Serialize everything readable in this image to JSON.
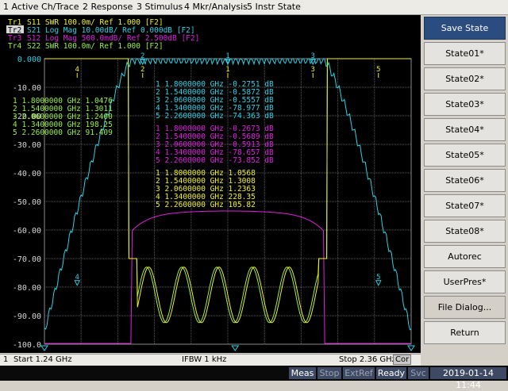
{
  "menu": [
    "1 Active Ch/Trace",
    "2 Response",
    "3 Stimulus",
    "4 Mkr/Analysis",
    "5 Instr State"
  ],
  "traces": [
    {
      "id": "Tr1",
      "param": "S11",
      "format": "SWR",
      "scale": "100.0m/",
      "ref": "Ref 1.000",
      "tag": "[F2]",
      "color": "#f2f21a",
      "active": false
    },
    {
      "id": "Tr2",
      "param": "S21",
      "format": "Log Mag",
      "scale": "10.00dB/",
      "ref": "Ref 0.000dB",
      "tag": "[F2]",
      "color": "#2ad2e6",
      "active": true
    },
    {
      "id": "Tr3",
      "param": "S12",
      "format": "Log Mag",
      "scale": "500.0mdB/",
      "ref": "Ref 2.500dB",
      "tag": "[F2]",
      "color": "#e01fe0",
      "active": false
    },
    {
      "id": "Tr4",
      "param": "S22",
      "format": "SWR",
      "scale": "100.0m/",
      "ref": "Ref 1.000",
      "tag": "[F2]",
      "color": "#9af03a",
      "active": false
    }
  ],
  "y_axis": {
    "labels": [
      "0.000",
      "-10.00",
      "-20.00",
      "-30.00",
      "-40.00",
      "-50.00",
      "-60.00",
      "-70.00",
      "-80.00",
      "-90.00",
      "-100.0"
    ],
    "ref_label_color": "#2ad2e6"
  },
  "markers": {
    "s21": [
      {
        "n": "1",
        "freq": "1.8000000 GHz",
        "val": "-0.2751 dB"
      },
      {
        "n": "2",
        "freq": "1.5400000 GHz",
        "val": "-0.5872 dB"
      },
      {
        "n": "3",
        "freq": "2.0600000 GHz",
        "val": "-0.5557 dB"
      },
      {
        "n": "4",
        "freq": "1.3400000 GHz",
        "val": "-78.977 dB"
      },
      {
        "n": "5",
        "freq": "2.2600000 GHz",
        "val": "-74.363 dB"
      }
    ],
    "s12": [
      {
        "n": "1",
        "freq": "1.8000000 GHz",
        "val": "-0.2673 dB"
      },
      {
        "n": "2",
        "freq": "1.5400000 GHz",
        "val": "-0.5689 dB"
      },
      {
        "n": "3",
        "freq": "2.0600000 GHz",
        "val": "-0.5913 dB"
      },
      {
        "n": "4",
        "freq": "1.3400000 GHz",
        "val": "-78.657 dB"
      },
      {
        "n": "5",
        "freq": "2.2600000 GHz",
        "val": "-73.852 dB"
      }
    ],
    "s11": [
      {
        "n": "1",
        "freq": "1.8000000 GHz",
        "val": "1.0568"
      },
      {
        "n": "2",
        "freq": "1.5400000 GHz",
        "val": "1.3008"
      },
      {
        "n": "3",
        "freq": "2.0600000 GHz",
        "val": "1.2363"
      },
      {
        "n": "4",
        "freq": "1.3400000 GHz",
        "val": "228.35"
      },
      {
        "n": "5",
        "freq": "2.2600000 GHz",
        "val": "105.82"
      }
    ],
    "s22": [
      {
        "n": "1",
        "freq": "1.8000000 GHz",
        "val": "1.0476"
      },
      {
        "n": "2",
        "freq": "1.5400000 GHz",
        "val": "1.3011"
      },
      {
        "n": "3",
        "freq": "2.0600000 GHz",
        "val": "1.2400"
      },
      {
        "n": "4",
        "freq": "1.3400000 GHz",
        "val": "198.25"
      },
      {
        "n": "5",
        "freq": "2.2600000 GHz",
        "val": "91.409"
      }
    ]
  },
  "softkeys": [
    "Save State",
    "State01*",
    "State02*",
    "State03*",
    "State04*",
    "State05*",
    "State06*",
    "State07*",
    "State08*",
    "Autorec",
    "UserPres*",
    "File Dialog...",
    "Return"
  ],
  "status": {
    "channel": "1",
    "start": "Start 1.24 GHz",
    "ifbw": "IFBW 1 kHz",
    "stop": "Stop 2.36 GHz",
    "cor": "Cor"
  },
  "indicators": [
    "Meas",
    "Stop",
    "ExtRef",
    "Ready",
    "Svc"
  ],
  "indicators_active": [
    true,
    false,
    false,
    true,
    false
  ],
  "datetime": "2019-01-14 11:44"
}
